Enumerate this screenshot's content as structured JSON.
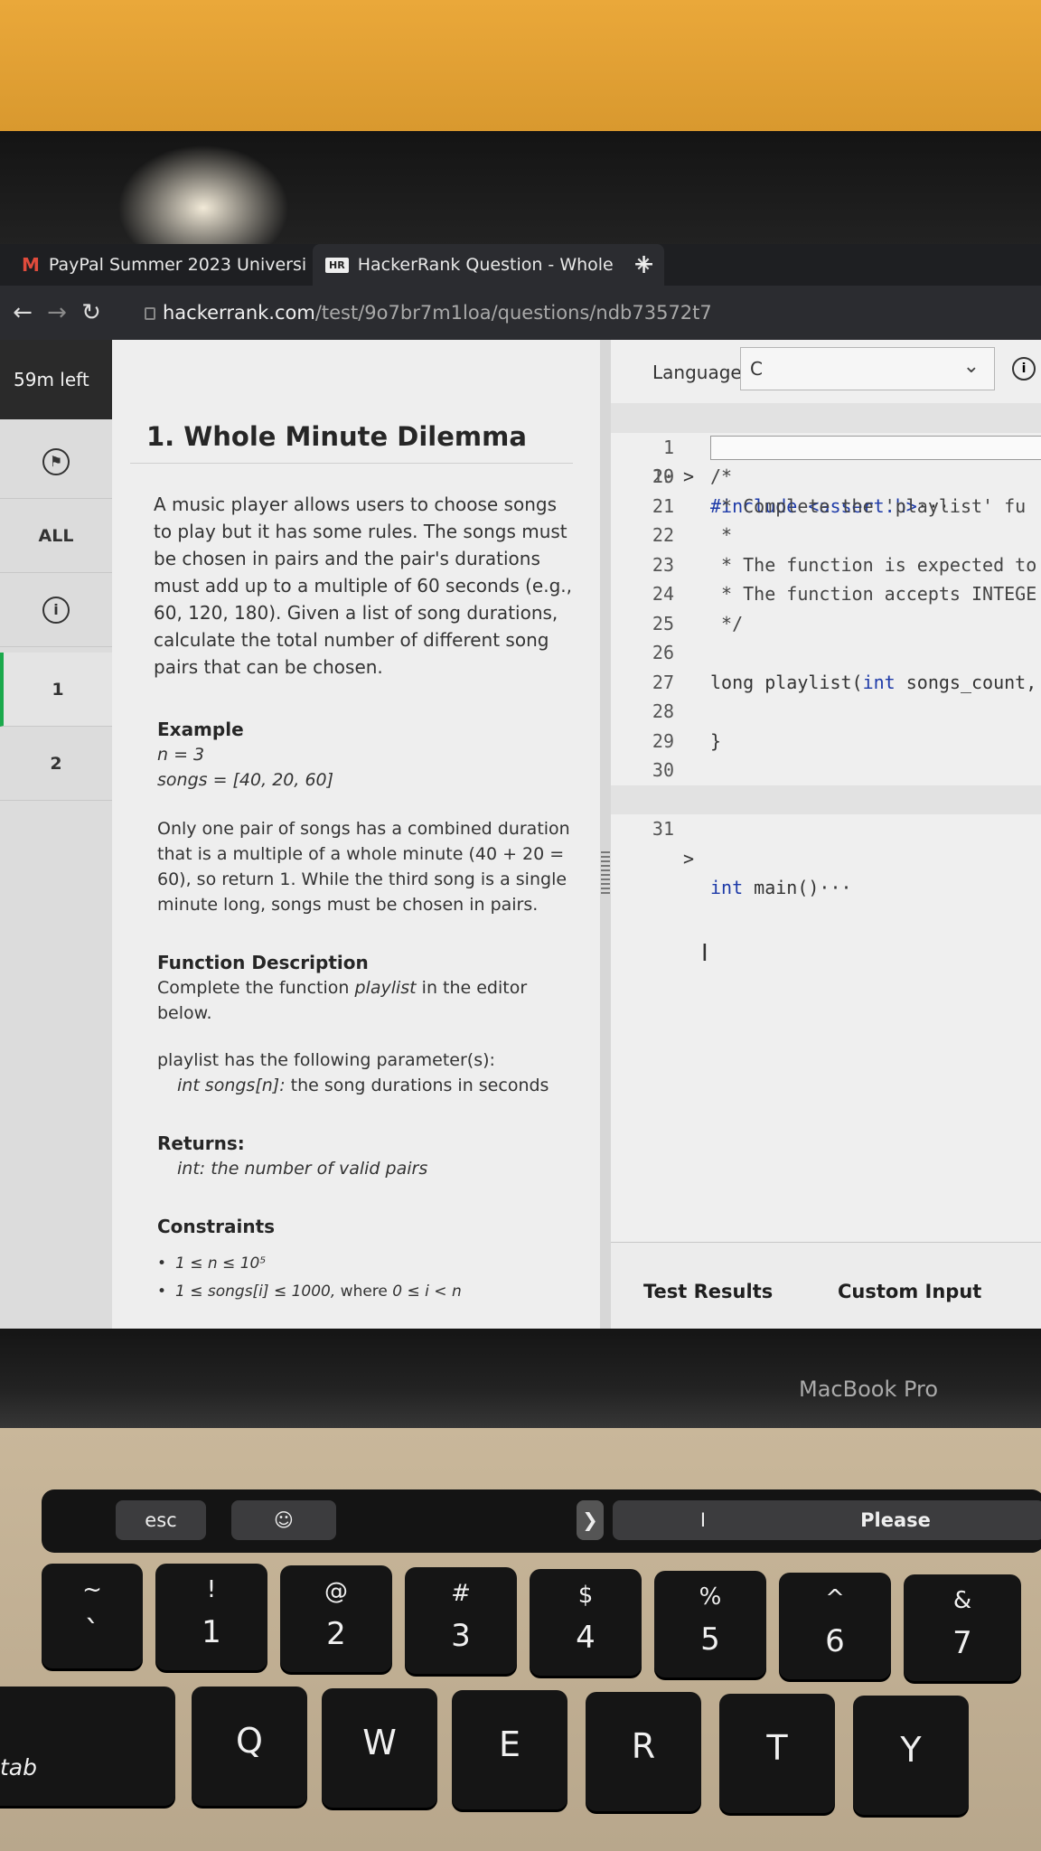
{
  "browser": {
    "tabs": [
      {
        "label": "PayPal Summer 2023 Universi",
        "icon": "gmail-icon"
      },
      {
        "label": "HackerRank Question - Whole",
        "icon": "hackerrank-icon"
      }
    ],
    "new_tab": "+",
    "url_host": "hackerrank.com",
    "url_path": "/test/9o7br7m1loa/questions/ndb73572t7"
  },
  "nav": {
    "timer": "59m left",
    "all": "ALL",
    "q1": "1",
    "q2": "2"
  },
  "problem": {
    "title": "1. Whole Minute Dilemma",
    "desc": "A music player allows users to choose songs to play but it has some rules. The songs must be chosen in pairs and the pair's durations must add up to a multiple of 60 seconds (e.g., 60, 120, 180). Given a list of song durations, calculate the total number of different song pairs that can be chosen.",
    "example_h": "Example",
    "example_n": "n = 3",
    "example_songs": "songs = [40, 20, 60]",
    "example_expl": "Only one pair of songs has a combined duration that is a multiple of a whole minute (40 + 20 = 60), so return 1. While the third song is a single minute long, songs must be chosen in pairs.",
    "fd_h": "Function Description",
    "fd_text_pre": "Complete the function ",
    "fd_fn": "playlist",
    "fd_text_post": " in the editor below.",
    "params_intro": "playlist has the following parameter(s):",
    "param_name": "int songs[n]:",
    "param_desc": " the song durations in seconds",
    "returns_h": "Returns:",
    "returns_text": "int: the number of valid pairs",
    "constraints_h": "Constraints",
    "constraint1": "1 ≤ n ≤ 10⁵",
    "constraint2_it": "1 ≤ songs[i] ≤ 1000,",
    "constraint2_mid": " where ",
    "constraint2_end": "0 ≤ i < n"
  },
  "editor": {
    "language_label": "Language",
    "language_value": "C",
    "lines": [
      {
        "n": "1",
        "fold": ">",
        "text": "#include <assert.h>",
        "more": "···"
      },
      {
        "n": "19",
        "text": ""
      },
      {
        "n": "20",
        "text": "/*"
      },
      {
        "n": "21",
        "text": " * Complete the 'playlist' fu"
      },
      {
        "n": "22",
        "text": " *"
      },
      {
        "n": "23",
        "text": " * The function is expected to"
      },
      {
        "n": "24",
        "text": " * The function accepts INTEGE"
      },
      {
        "n": "25",
        "text": " */"
      },
      {
        "n": "26",
        "text": ""
      },
      {
        "n": "27",
        "text_a": "long playlist(",
        "text_kw": "int",
        "text_b": " songs_count,"
      },
      {
        "n": "28",
        "text": ""
      },
      {
        "n": "29",
        "text": "}"
      },
      {
        "n": "30",
        "text": ""
      },
      {
        "n": "31",
        "fold": ">",
        "text_kw": "int",
        "text_b": " main()",
        "more": "···"
      }
    ],
    "footer_tabs": [
      "Test Results",
      "Custom Input"
    ]
  },
  "hardware": {
    "brand": "MacBook Pro",
    "touchbar": {
      "esc": "esc",
      "arrow": "❯",
      "suggestion_1": "I",
      "suggestion_2": "Please"
    },
    "keys_row1": [
      {
        "top": "~",
        "bot": "`"
      },
      {
        "top": "!",
        "bot": "1"
      },
      {
        "top": "@",
        "bot": "2"
      },
      {
        "top": "#",
        "bot": "3"
      },
      {
        "top": "$",
        "bot": "4"
      },
      {
        "top": "%",
        "bot": "5"
      },
      {
        "top": "^",
        "bot": "6"
      },
      {
        "top": "&",
        "bot": "7"
      }
    ],
    "keys_row2": [
      "Q",
      "W",
      "E",
      "R",
      "T",
      "Y"
    ],
    "tab_key": "tab"
  }
}
